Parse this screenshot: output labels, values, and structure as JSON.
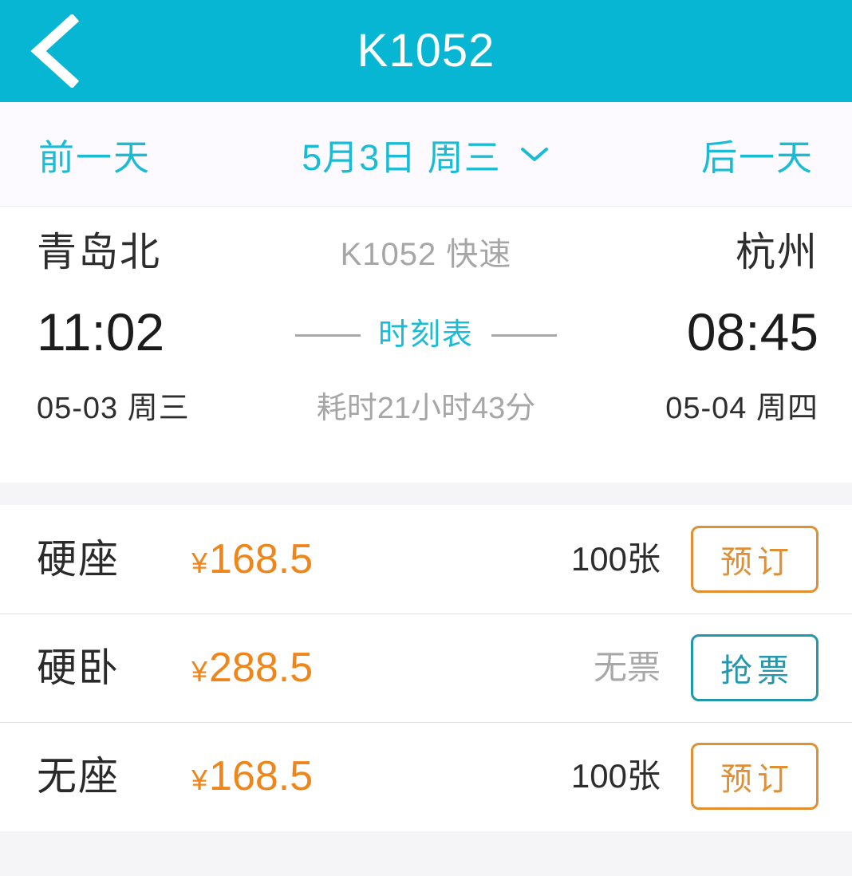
{
  "navbar": {
    "title": "K1052",
    "back_icon": "chevron-left-icon"
  },
  "datebar": {
    "prev_day": "前一天",
    "current_date": "5月3日 周三",
    "next_day": "后一天",
    "dropdown_icon": "chevron-down-icon"
  },
  "trip": {
    "from_station": "青岛北",
    "from_time": "11:02",
    "from_date": "05-03 周三",
    "to_station": "杭州",
    "to_time": "08:45",
    "to_date": "05-04 周四",
    "train_code": "K1052  快速",
    "timetable_label": "时刻表",
    "duration": "耗时21小时43分"
  },
  "seats": [
    {
      "name": "硬座",
      "currency": "¥",
      "price": "168.5",
      "count": "100张",
      "count_state": "avail",
      "button_label": "预订",
      "button_style": "book"
    },
    {
      "name": "硬卧",
      "currency": "¥",
      "price": "288.5",
      "count": "无票",
      "count_state": "none",
      "button_label": "抢票",
      "button_style": "grab"
    },
    {
      "name": "无座",
      "currency": "¥",
      "price": "168.5",
      "count": "100张",
      "count_state": "avail",
      "button_label": "预订",
      "button_style": "book"
    }
  ],
  "colors": {
    "brand_teal": "#07b6d2",
    "accent_teal": "#19bcd4",
    "price_orange": "#f08519",
    "button_orange": "#e08f34",
    "button_teal": "#2397ad",
    "muted_gray": "#a6a6a6",
    "band_gray": "#f5f5f7"
  }
}
